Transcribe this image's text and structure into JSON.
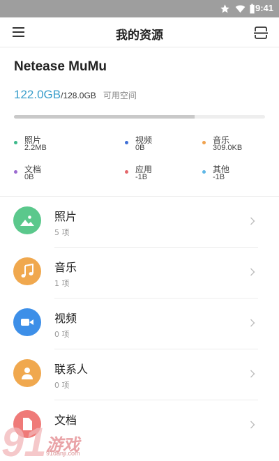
{
  "statusbar": {
    "time": "9:41",
    "icons": [
      "star-icon",
      "wifi-icon",
      "battery-icon"
    ]
  },
  "appbar": {
    "title": "我的资源",
    "left_icon": "menu-icon",
    "right_icon": "scan-icon"
  },
  "device": {
    "name": "Netease MuMu",
    "used": "122.0GB",
    "total": "/128.0GB",
    "free_label": "可用空间",
    "used_fraction": 0.72
  },
  "categories": [
    {
      "name": "照片",
      "value": "2.2MB",
      "color": "#3cb98a"
    },
    {
      "name": "视频",
      "value": "0B",
      "color": "#3f6fd6"
    },
    {
      "name": "音乐",
      "value": "309.0KB",
      "color": "#f0a24e"
    },
    {
      "name": "文档",
      "value": "0B",
      "color": "#9b6ad0"
    },
    {
      "name": "应用",
      "value": "-1B",
      "color": "#e4676b"
    },
    {
      "name": "其他",
      "value": "-1B",
      "color": "#5fb7e6"
    }
  ],
  "list": [
    {
      "title": "照片",
      "count": "5 项",
      "color": "#5bc88c",
      "icon": "photo-icon"
    },
    {
      "title": "音乐",
      "count": "1 项",
      "color": "#f0a84e",
      "icon": "music-icon"
    },
    {
      "title": "视频",
      "count": "0 项",
      "color": "#3d8fe8",
      "icon": "video-icon"
    },
    {
      "title": "联系人",
      "count": "0 项",
      "color": "#f0a84e",
      "icon": "contact-icon"
    },
    {
      "title": "文档",
      "count": "",
      "color": "#ef7a78",
      "icon": "document-icon"
    }
  ],
  "watermark": {
    "text": "游戏",
    "url": "91danji.com"
  }
}
